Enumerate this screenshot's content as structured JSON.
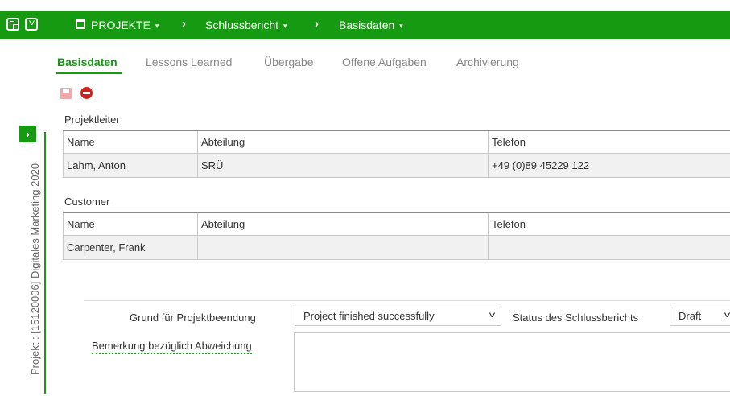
{
  "topbar": {
    "projects_label": "PROJEKTE",
    "separator": "›",
    "crumb_report": "Schlussbericht",
    "crumb_page": "Basisdaten",
    "caret": "▾"
  },
  "sidebar": {
    "expand_glyph": "›",
    "project_title": "Projekt : [15120006] Digitales Marketing 2020"
  },
  "tabs": [
    {
      "label": "Basisdaten",
      "active": true
    },
    {
      "label": "Lessons Learned"
    },
    {
      "label": "Übergabe"
    },
    {
      "label": "Offene Aufgaben"
    },
    {
      "label": "Archivierung"
    }
  ],
  "projektleiter": {
    "title": "Projektleiter",
    "columns": [
      "Name",
      "Abteilung",
      "Telefon"
    ],
    "row": [
      "Lahm, Anton",
      "SRÜ",
      "+49 (0)89 45229 122"
    ]
  },
  "customer": {
    "title": "Customer",
    "columns": [
      "Name",
      "Abteilung",
      "Telefon"
    ],
    "row": [
      "Carpenter, Frank",
      "",
      ""
    ]
  },
  "form": {
    "reason_label": "Grund für Projektbeendung",
    "reason_value": "Project finished successfully",
    "status_label": "Status des Schlussberichts",
    "status_value": "Draft",
    "remark_label": "Bemerkung bezüglich Abweichung",
    "chevron": "⌄"
  },
  "colors": {
    "accent": "#159a12",
    "danger": "#d0201c"
  },
  "icons": [
    "window-icon",
    "chevron-down-icon",
    "calendar-icon",
    "save-icon",
    "stop-icon",
    "expand-icon"
  ]
}
